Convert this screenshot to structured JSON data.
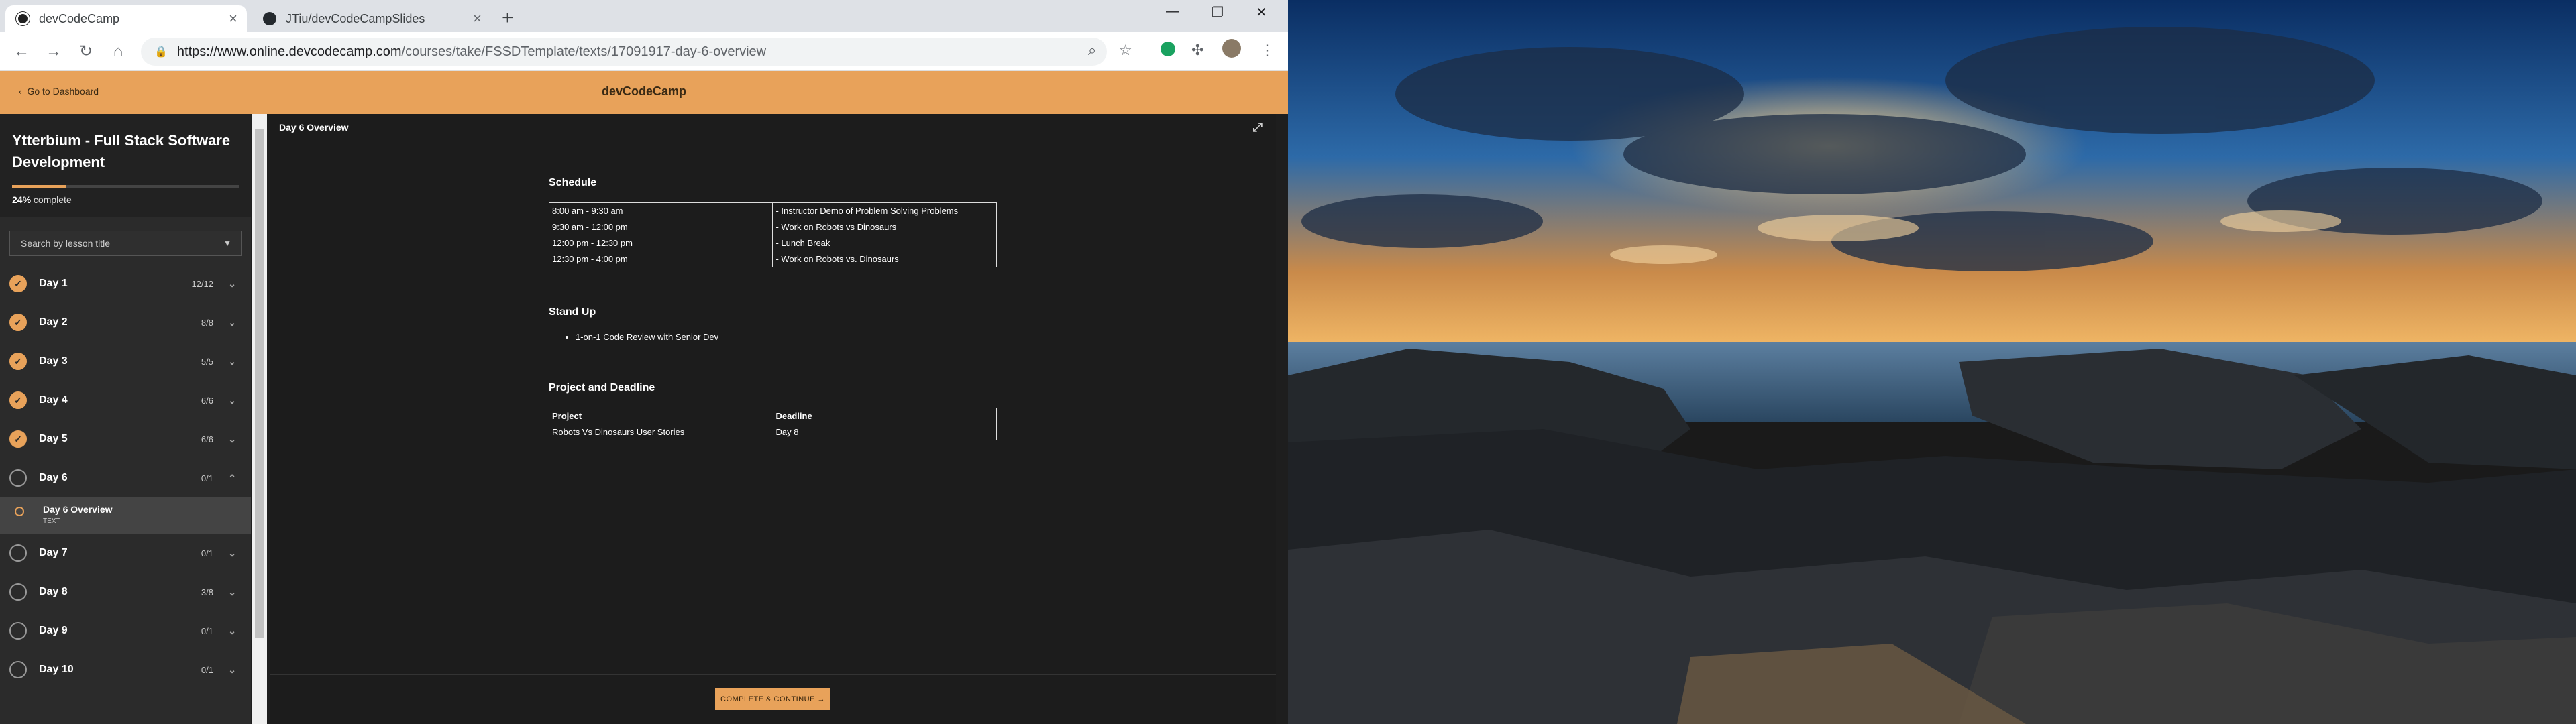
{
  "browser": {
    "tabs": [
      {
        "label": "devCodeCamp",
        "active": true
      },
      {
        "label": "JTiu/devCodeCampSlides",
        "active": false
      }
    ],
    "url_host": "https://www.online.devcodecamp.com",
    "url_path": "/courses/take/FSSDTemplate/texts/17091917-day-6-overview"
  },
  "header": {
    "back_label": "Go to Dashboard",
    "brand": "devCodeCamp"
  },
  "sidebar": {
    "course_title": "Ytterbium - Full Stack Software Development",
    "progress_percent": 24,
    "progress_pct_label": "24%",
    "progress_label_suffix": " complete",
    "search_placeholder": "Search by lesson title",
    "days": [
      {
        "label": "Day 1",
        "count": "12/12",
        "done": true
      },
      {
        "label": "Day 2",
        "count": "8/8",
        "done": true
      },
      {
        "label": "Day 3",
        "count": "5/5",
        "done": true
      },
      {
        "label": "Day 4",
        "count": "6/6",
        "done": true
      },
      {
        "label": "Day 5",
        "count": "6/6",
        "done": true
      },
      {
        "label": "Day 6",
        "count": "0/1",
        "done": false
      },
      {
        "label": "Day 7",
        "count": "0/1",
        "done": false
      },
      {
        "label": "Day 8",
        "count": "3/8",
        "done": false
      },
      {
        "label": "Day 9",
        "count": "0/1",
        "done": false
      },
      {
        "label": "Day 10",
        "count": "0/1",
        "done": false
      }
    ],
    "active_lesson": {
      "title": "Day 6 Overview",
      "kind": "TEXT"
    }
  },
  "main": {
    "title": "Day 6 Overview",
    "schedule_heading": "Schedule",
    "schedule": [
      [
        "8:00 am - 9:30 am",
        "- Instructor Demo of Problem Solving Problems"
      ],
      [
        "9:30 am - 12:00 pm",
        "- Work on Robots vs Dinosaurs"
      ],
      [
        "12:00 pm - 12:30 pm",
        "- Lunch Break"
      ],
      [
        "12:30 pm - 4:00 pm",
        "- Work on Robots vs. Dinosaurs"
      ]
    ],
    "standup_heading": "Stand Up",
    "standup_items": [
      "1-on-1 Code Review with Senior Dev"
    ],
    "project_heading": "Project and Deadline",
    "project_headers": [
      "Project",
      "Deadline"
    ],
    "project_rows": [
      [
        "Robots Vs Dinosaurs User Stories",
        "Day 8"
      ]
    ],
    "cta_label": "COMPLETE & CONTINUE →"
  },
  "colors": {
    "accent": "#e8a25a",
    "sidebar_bg": "#2b2b2b",
    "main_bg": "#1c1c1c"
  }
}
